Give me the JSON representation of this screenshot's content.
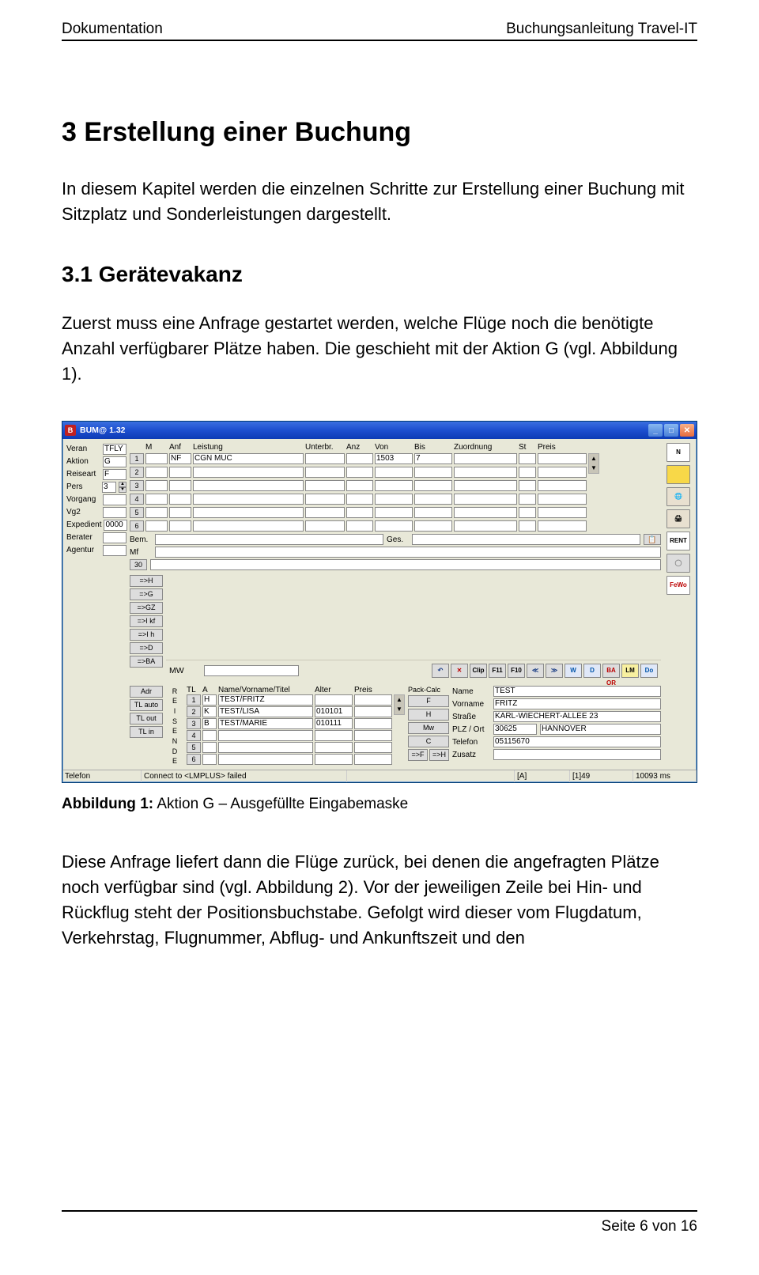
{
  "header": {
    "left": "Dokumentation",
    "right": "Buchungsanleitung Travel-IT"
  },
  "h1": "3  Erstellung einer Buchung",
  "p1": "In diesem Kapitel werden die einzelnen Schritte zur Erstellung einer Buchung mit Sitzplatz und Sonderleistungen dargestellt.",
  "h2": "3.1 Gerätevakanz",
  "p2": "Zuerst muss eine Anfrage gestartet werden, welche Flüge noch die benötigte Anzahl verfügbarer Plätze haben. Die geschieht mit der Aktion G (vgl. Abbildung 1).",
  "caption_bold": "Abbildung 1:",
  "caption_rest": " Aktion G – Ausgefüllte Eingabemaske",
  "p3": "Diese Anfrage liefert dann die Flüge zurück, bei denen die angefragten Plätze noch verfügbar sind (vgl. Abbildung 2). Vor der jeweiligen Zeile bei Hin- und Rückflug steht der Positionsbuchstabe. Gefolgt wird dieser vom Flugdatum, Verkehrstag, Flugnummer, Abflug- und Ankunftszeit und den",
  "footer": "Seite 6 von 16",
  "win": {
    "title": "BUM@ 1.32",
    "icon": "B",
    "left_labels": [
      "Veran",
      "Aktion",
      "Reiseart",
      "Pers",
      "Vorgang",
      "Vg2",
      "Expedient",
      "Berater",
      "Agentur"
    ],
    "left_vals": {
      "Veran": "TFLY",
      "Aktion": "G",
      "Reiseart": "F",
      "Pers": "3",
      "Expedient": "0000"
    },
    "cols": [
      "M",
      "Anf",
      "Leistung",
      "Unterbr.",
      "Anz",
      "Von",
      "Bis",
      "Zuordnung",
      "St",
      "Preis"
    ],
    "row1": {
      "anf": "NF",
      "leistung": "CGN MUC",
      "von": "1503",
      "bis": "7"
    },
    "bem": "Bem.",
    "mf": "Mf",
    "ges": "Ges.",
    "num30": "30",
    "actions": [
      "=>H",
      "=>G",
      "=>GZ",
      "=>I kf",
      "=>I h",
      "=>D",
      "=>BA"
    ],
    "mw": "MW",
    "toolbar": [
      "↶",
      "✕",
      "Clip",
      "F11",
      "F10",
      "≪",
      "≫",
      "W",
      "D",
      "BA OR",
      "LM",
      "Do"
    ],
    "reisende": "REISENDE",
    "pax_cols": [
      "TL",
      "A",
      "Name/Vorname/Titel",
      "Alter",
      "Preis"
    ],
    "pax": [
      {
        "n": "1",
        "a": "H",
        "name": "TEST/FRITZ",
        "alter": "",
        "preis": ""
      },
      {
        "n": "2",
        "a": "K",
        "name": "TEST/LISA",
        "alter": "010101",
        "preis": ""
      },
      {
        "n": "3",
        "a": "B",
        "name": "TEST/MARIE",
        "alter": "010111",
        "preis": ""
      },
      {
        "n": "4",
        "a": "",
        "name": "",
        "alter": "",
        "preis": ""
      },
      {
        "n": "5",
        "a": "",
        "name": "",
        "alter": "",
        "preis": ""
      },
      {
        "n": "6",
        "a": "",
        "name": "",
        "alter": "",
        "preis": ""
      }
    ],
    "pack": "Pack-Calc",
    "pack_btns": [
      "F",
      "H",
      "Mw",
      "C",
      "=>F",
      "=>H"
    ],
    "tl_btns": [
      "Adr",
      "TL auto",
      "TL out",
      "TL in"
    ],
    "addr_labels": [
      "Name",
      "Vorname",
      "Straße",
      "PLZ / Ort",
      "Telefon",
      "Zusatz"
    ],
    "addr": {
      "Name": "TEST",
      "Vorname": "FRITZ",
      "Strasse": "KARL-WIECHERT-ALLEE 23",
      "PLZ": "30625",
      "Ort": "HANNOVER",
      "Telefon": "05115670"
    },
    "right_icons": [
      "N",
      "",
      "",
      "",
      "RENT",
      "",
      "FeWo"
    ],
    "status": [
      "Telefon",
      "Connect to <LMPLUS> failed",
      "",
      "[A]",
      "[1]49",
      "10093 ms"
    ],
    "copy_icon": "📋"
  }
}
